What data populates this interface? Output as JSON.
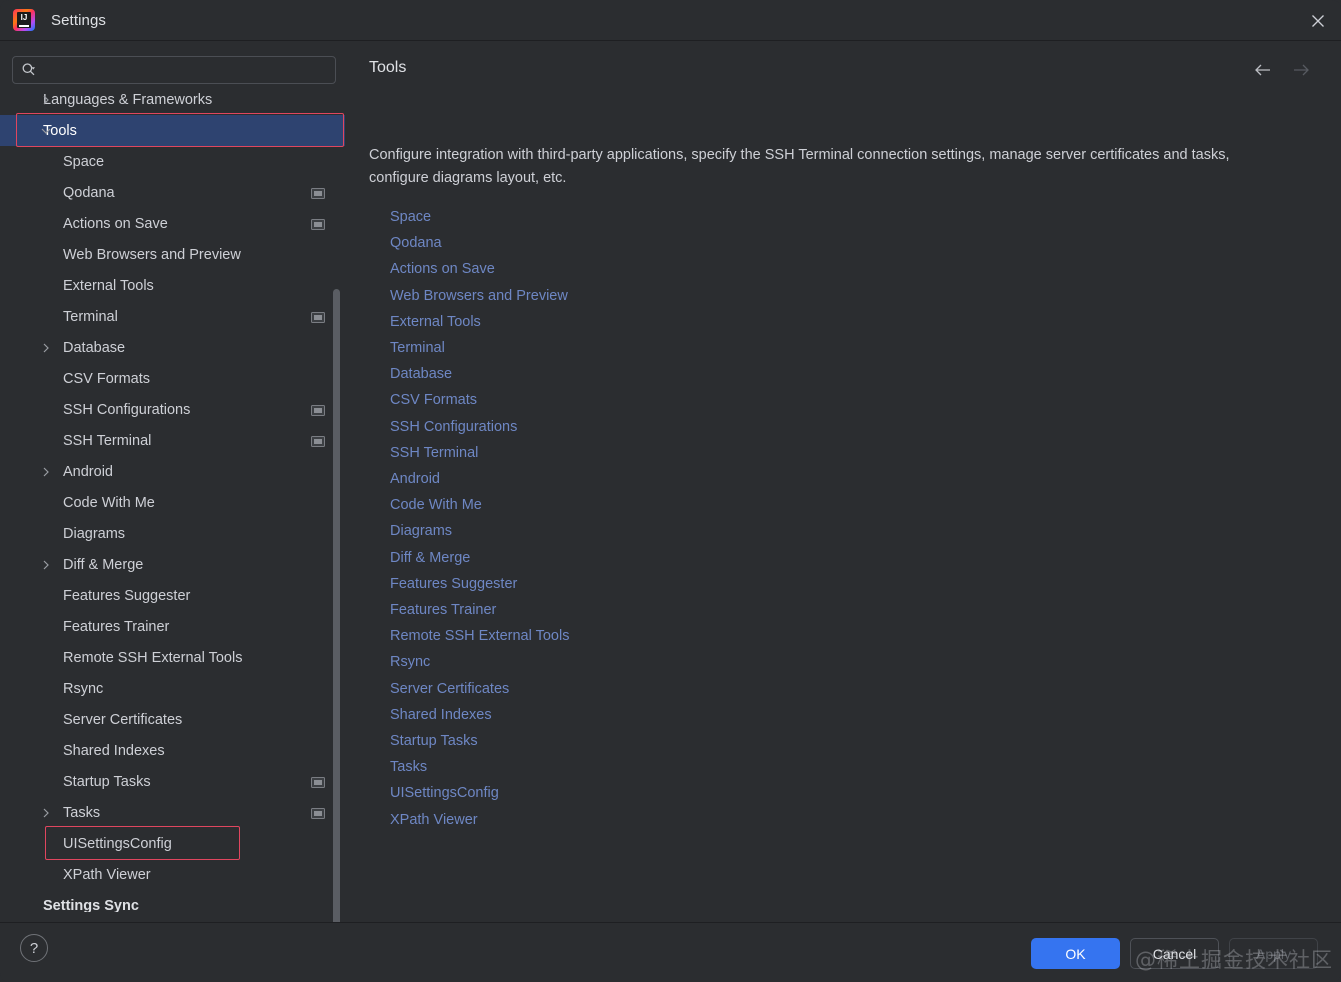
{
  "window": {
    "title": "Settings",
    "app_icon": "intellij-idea-icon",
    "close_icon": "close-icon"
  },
  "search": {
    "value": "",
    "placeholder": "",
    "icon": "search-icon"
  },
  "sidebar": {
    "scrollbar": "vertical-scrollbar",
    "items": [
      {
        "label": "Languages & Frameworks",
        "indent": 1,
        "twisty": "chevron-right",
        "selected": false,
        "project_icon": false,
        "bold": false,
        "clipped": true
      },
      {
        "label": "Tools",
        "indent": 1,
        "twisty": "chevron-down",
        "selected": true,
        "project_icon": false,
        "bold": false,
        "annotated": true
      },
      {
        "label": "Space",
        "indent": 2,
        "twisty": "",
        "selected": false,
        "project_icon": false,
        "bold": false
      },
      {
        "label": "Qodana",
        "indent": 2,
        "twisty": "",
        "selected": false,
        "project_icon": true,
        "bold": false
      },
      {
        "label": "Actions on Save",
        "indent": 2,
        "twisty": "",
        "selected": false,
        "project_icon": true,
        "bold": false
      },
      {
        "label": "Web Browsers and Preview",
        "indent": 2,
        "twisty": "",
        "selected": false,
        "project_icon": false,
        "bold": false
      },
      {
        "label": "External Tools",
        "indent": 2,
        "twisty": "",
        "selected": false,
        "project_icon": false,
        "bold": false
      },
      {
        "label": "Terminal",
        "indent": 2,
        "twisty": "",
        "selected": false,
        "project_icon": true,
        "bold": false
      },
      {
        "label": "Database",
        "indent": 2,
        "twisty": "chevron-right",
        "selected": false,
        "project_icon": false,
        "bold": false
      },
      {
        "label": "CSV Formats",
        "indent": 2,
        "twisty": "",
        "selected": false,
        "project_icon": false,
        "bold": false
      },
      {
        "label": "SSH Configurations",
        "indent": 2,
        "twisty": "",
        "selected": false,
        "project_icon": true,
        "bold": false
      },
      {
        "label": "SSH Terminal",
        "indent": 2,
        "twisty": "",
        "selected": false,
        "project_icon": true,
        "bold": false
      },
      {
        "label": "Android",
        "indent": 2,
        "twisty": "chevron-right",
        "selected": false,
        "project_icon": false,
        "bold": false
      },
      {
        "label": "Code With Me",
        "indent": 2,
        "twisty": "",
        "selected": false,
        "project_icon": false,
        "bold": false
      },
      {
        "label": "Diagrams",
        "indent": 2,
        "twisty": "",
        "selected": false,
        "project_icon": false,
        "bold": false
      },
      {
        "label": "Diff & Merge",
        "indent": 2,
        "twisty": "chevron-right",
        "selected": false,
        "project_icon": false,
        "bold": false
      },
      {
        "label": "Features Suggester",
        "indent": 2,
        "twisty": "",
        "selected": false,
        "project_icon": false,
        "bold": false
      },
      {
        "label": "Features Trainer",
        "indent": 2,
        "twisty": "",
        "selected": false,
        "project_icon": false,
        "bold": false
      },
      {
        "label": "Remote SSH External Tools",
        "indent": 2,
        "twisty": "",
        "selected": false,
        "project_icon": false,
        "bold": false
      },
      {
        "label": "Rsync",
        "indent": 2,
        "twisty": "",
        "selected": false,
        "project_icon": false,
        "bold": false
      },
      {
        "label": "Server Certificates",
        "indent": 2,
        "twisty": "",
        "selected": false,
        "project_icon": false,
        "bold": false
      },
      {
        "label": "Shared Indexes",
        "indent": 2,
        "twisty": "",
        "selected": false,
        "project_icon": false,
        "bold": false
      },
      {
        "label": "Startup Tasks",
        "indent": 2,
        "twisty": "",
        "selected": false,
        "project_icon": true,
        "bold": false
      },
      {
        "label": "Tasks",
        "indent": 2,
        "twisty": "chevron-right",
        "selected": false,
        "project_icon": true,
        "bold": false
      },
      {
        "label": "UISettingsConfig",
        "indent": 2,
        "twisty": "",
        "selected": false,
        "project_icon": false,
        "bold": false,
        "annotated": true
      },
      {
        "label": "XPath Viewer",
        "indent": 2,
        "twisty": "",
        "selected": false,
        "project_icon": false,
        "bold": false
      },
      {
        "label": "Settings Sync",
        "indent": 1,
        "twisty": "",
        "selected": false,
        "project_icon": false,
        "bold": true
      }
    ]
  },
  "content": {
    "title": "Tools",
    "description": "Configure integration with third-party applications, specify the SSH Terminal connection settings, manage server certificates and tasks, configure diagrams layout, etc.",
    "back_icon": "arrow-left-icon",
    "forward_icon": "arrow-right-icon",
    "links": [
      "Space",
      "Qodana",
      "Actions on Save",
      "Web Browsers and Preview",
      "External Tools",
      "Terminal",
      "Database",
      "CSV Formats",
      "SSH Configurations",
      "SSH Terminal",
      "Android",
      "Code With Me",
      "Diagrams",
      "Diff & Merge",
      "Features Suggester",
      "Features Trainer",
      "Remote SSH External Tools",
      "Rsync",
      "Server Certificates",
      "Shared Indexes",
      "Startup Tasks",
      "Tasks",
      "UISettingsConfig",
      "XPath Viewer"
    ]
  },
  "footer": {
    "help_label": "?",
    "help_icon": "help-icon",
    "ok_label": "OK",
    "cancel_label": "Cancel",
    "apply_label": "Apply"
  },
  "watermark": "@稀土掘金技术社区",
  "colors": {
    "window_bg": "#2b2d30",
    "selection_blue": "#2e4370",
    "link_blue": "#6e87c4",
    "primary_button": "#3574f0",
    "annotation_red": "#e0465f",
    "text": "#ced0d6"
  }
}
